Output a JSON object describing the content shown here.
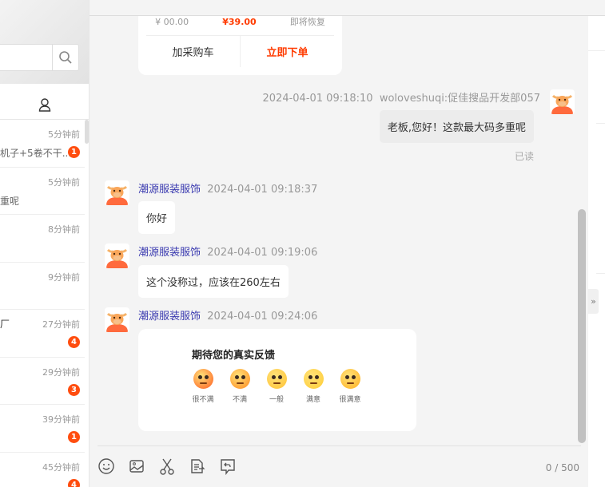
{
  "sidebar": {
    "search_placeholder": "",
    "conversations": [
      {
        "name": "",
        "preview": "机子+5卷不干...",
        "time": "5分钟前",
        "badge": "1"
      },
      {
        "name": "",
        "preview": "重呢",
        "time": "5分钟前",
        "badge": ""
      },
      {
        "name": "",
        "preview": "",
        "time": "8分钟前",
        "badge": ""
      },
      {
        "name": "",
        "preview": "",
        "time": "9分钟前",
        "badge": ""
      },
      {
        "name": "厂",
        "preview": "",
        "time": "27分钟前",
        "badge": "4"
      },
      {
        "name": "",
        "preview": "",
        "time": "29分钟前",
        "badge": "3"
      },
      {
        "name": "",
        "preview": "",
        "time": "39分钟前",
        "badge": "1"
      },
      {
        "name": "",
        "preview": "",
        "time": "45分钟前",
        "badge": "4"
      }
    ]
  },
  "product_card": {
    "price_original": "¥ 00.00",
    "price": "¥39.00",
    "stock": "即将恢复",
    "add_cart": "加采购车",
    "buy_now": "立即下单"
  },
  "messages": [
    {
      "direction": "out",
      "time": "2024-04-01 09:18:10",
      "sender": "woloveshuqi:促佳搜品开发部057",
      "text": "老板,您好！这款最大码多重呢",
      "status": "已读"
    },
    {
      "direction": "in",
      "sender": "潮源服装服饰",
      "time": "2024-04-01 09:18:37",
      "text": "你好"
    },
    {
      "direction": "in",
      "sender": "潮源服装服饰",
      "time": "2024-04-01 09:19:06",
      "text": "这个没称过，应该在260左右"
    },
    {
      "direction": "in",
      "sender": "潮源服装服饰",
      "time": "2024-04-01 09:24:06"
    }
  ],
  "feedback": {
    "title": "期待您的真实反馈",
    "options": [
      {
        "label": "很不满",
        "color": "#ff5a1f"
      },
      {
        "label": "不满",
        "color": "#ff8a1f"
      },
      {
        "label": "一般",
        "color": "#ffc233"
      },
      {
        "label": "满意",
        "color": "#ffcc33"
      },
      {
        "label": "很满意",
        "color": "#ffb020"
      }
    ]
  },
  "composer": {
    "count": "0 / 500"
  },
  "colors": {
    "accent": "#ff3b00",
    "badge": "#ff4d0f",
    "shop": "#3b3bb0"
  }
}
